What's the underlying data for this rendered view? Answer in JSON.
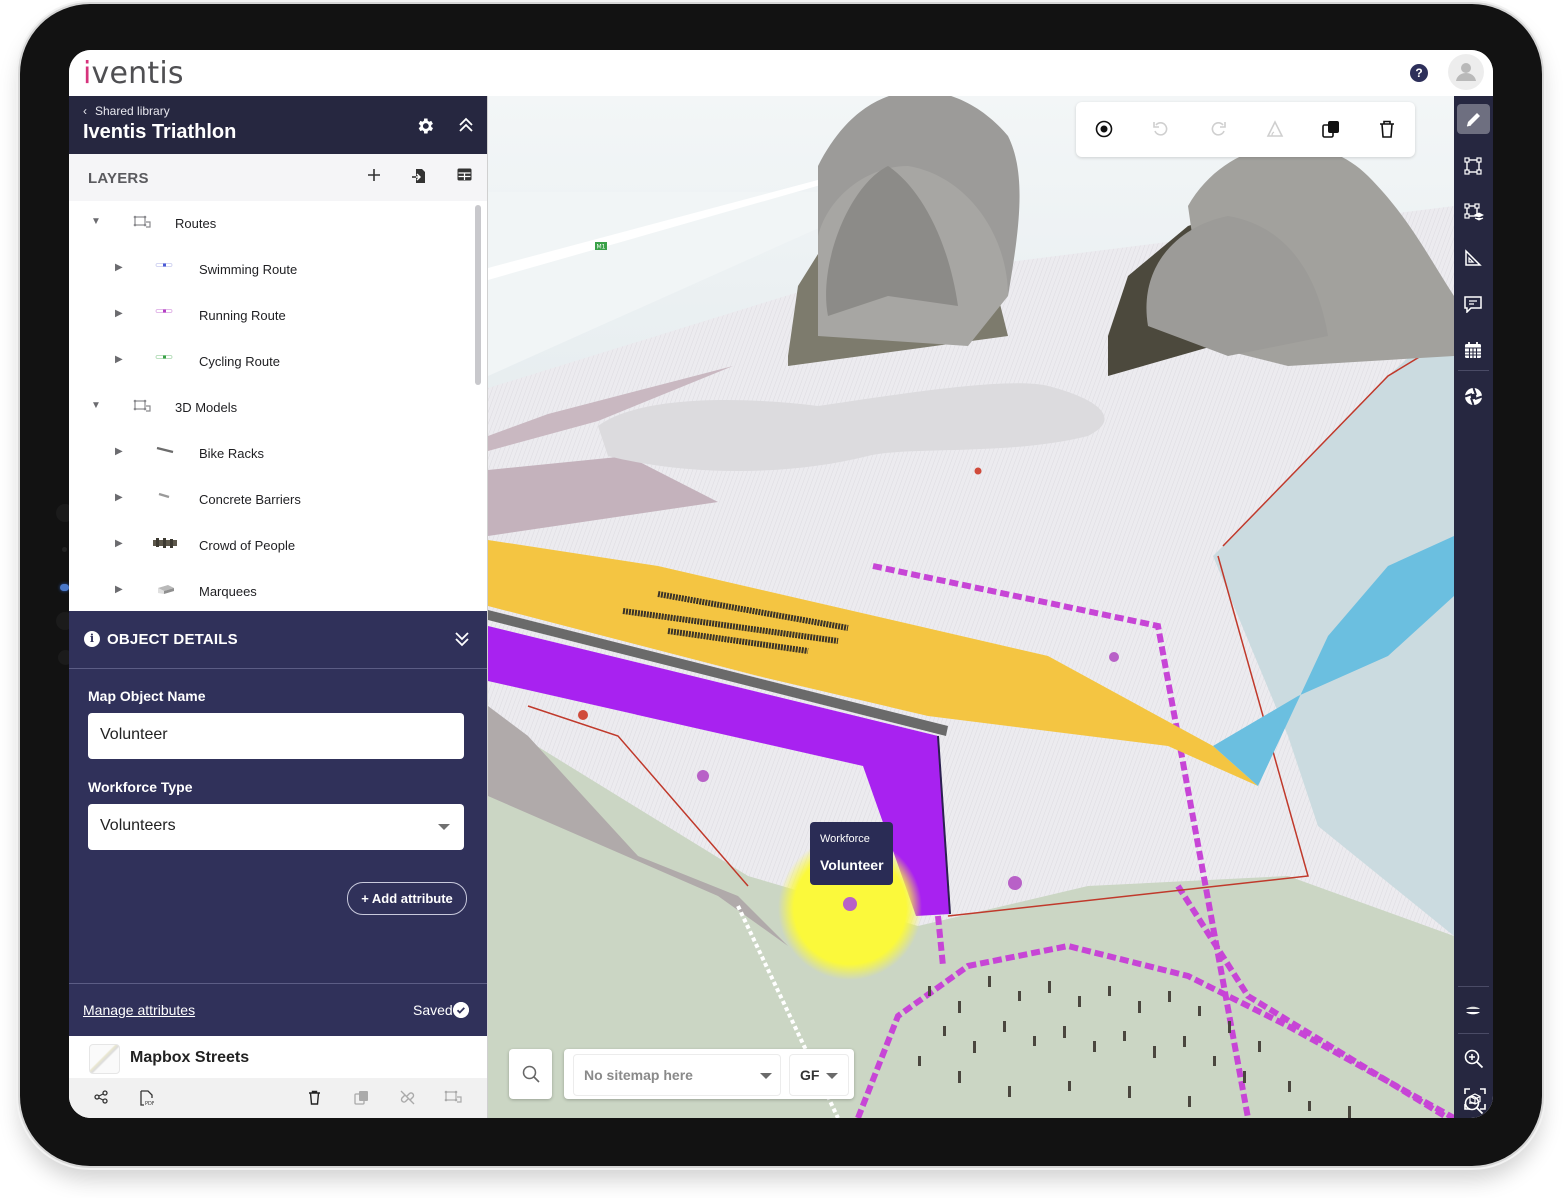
{
  "app": {
    "logo": "iventis",
    "help_label": "?",
    "help_icon": "help-circle-icon",
    "avatar_icon": "user-avatar-icon"
  },
  "project": {
    "breadcrumb": "Shared library",
    "title": "Iventis Triathlon"
  },
  "layers": {
    "header": "LAYERS",
    "actions": [
      "add-icon",
      "import-icon",
      "table-icon"
    ],
    "items": [
      {
        "label": "Routes",
        "level": 0,
        "expanded": true,
        "icon": "layer-group-icon"
      },
      {
        "label": "Swimming Route",
        "level": 1,
        "expanded": false,
        "icon": "route-line-icon",
        "color": "#4b5ad6"
      },
      {
        "label": "Running Route",
        "level": 1,
        "expanded": false,
        "icon": "route-line-icon",
        "color": "#b43fc4"
      },
      {
        "label": "Cycling Route",
        "level": 1,
        "expanded": false,
        "icon": "route-line-icon",
        "color": "#3aa148"
      },
      {
        "label": "3D Models",
        "level": 0,
        "expanded": true,
        "icon": "layer-group-icon"
      },
      {
        "label": "Bike Racks",
        "level": 1,
        "expanded": false,
        "icon": "bike-rack-model-icon"
      },
      {
        "label": "Concrete Barriers",
        "level": 1,
        "expanded": false,
        "icon": "barrier-model-icon"
      },
      {
        "label": "Crowd of People",
        "level": 1,
        "expanded": false,
        "icon": "crowd-model-icon"
      },
      {
        "label": "Marquees",
        "level": 1,
        "expanded": false,
        "icon": "marquee-model-icon"
      }
    ]
  },
  "object_details": {
    "header": "OBJECT DETAILS",
    "name_label": "Map Object Name",
    "name_value": "Volunteer",
    "type_label": "Workforce Type",
    "type_value": "Volunteers",
    "add_attribute": "+ Add attribute",
    "manage_attributes": "Manage attributes",
    "status": "Saved"
  },
  "basemap": {
    "name": "Mapbox Streets"
  },
  "bottom_toolbar": [
    "share-icon",
    "pdf-export-icon",
    "delete-icon",
    "copy-icon",
    "unlink-icon",
    "group-icon"
  ],
  "edit_toolbar": [
    "select-point-icon",
    "undo-icon",
    "redo-icon",
    "measure-angle-icon",
    "duplicate-icon",
    "delete-icon"
  ],
  "map": {
    "road_label": "M1",
    "tooltip": {
      "category": "Workforce",
      "name": "Volunteer"
    },
    "sitemap_value": "No sitemap here",
    "floor_value": "GF",
    "colors": {
      "water": "#cbdbe0",
      "marquee_zone": "#f4c542",
      "selected_area": "#a822f0",
      "pool": "#6bbfe0",
      "route": "#c745d6",
      "highlight": "#fbf93b"
    }
  },
  "right_rail": {
    "top": [
      "edit-pencil-icon",
      "draw-area-icon",
      "layers-area-icon",
      "measure-ruler-icon",
      "comment-icon",
      "calendar-icon",
      "aperture-icon"
    ],
    "bottom": [
      "terrain-icon",
      "zoom-in-icon",
      "zoom-out-icon",
      "3d-view-icon"
    ]
  }
}
